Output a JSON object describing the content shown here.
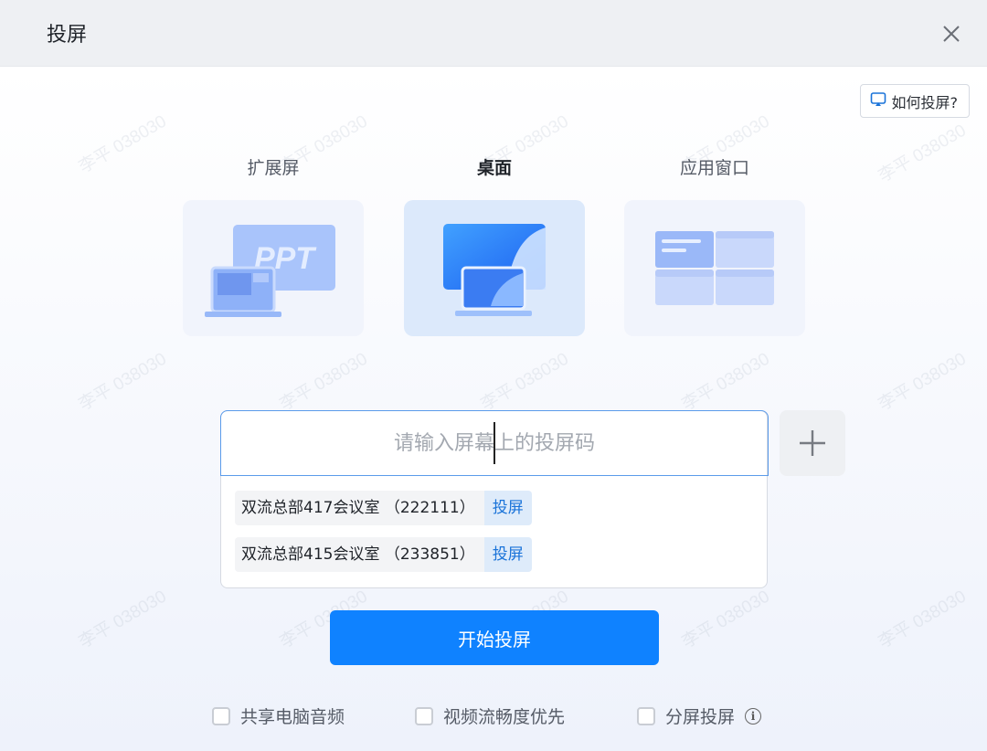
{
  "window": {
    "title": "投屏"
  },
  "watermark": "李平 038030",
  "help": {
    "label": "如何投屏?"
  },
  "modes": [
    {
      "label": "扩展屏",
      "card_text": "PPT",
      "active": false
    },
    {
      "label": "桌面",
      "active": true
    },
    {
      "label": "应用窗口",
      "active": false
    }
  ],
  "input": {
    "placeholder": "请输入屏幕上的投屏码",
    "value": ""
  },
  "recent": [
    {
      "name": "双流总部417会议室 （222111）",
      "action": "投屏"
    },
    {
      "name": "双流总部415会议室 （233851）",
      "action": "投屏"
    }
  ],
  "start": {
    "label": "开始投屏"
  },
  "options": [
    {
      "label": "共享电脑音频",
      "checked": false
    },
    {
      "label": "视频流畅度优先",
      "checked": false
    },
    {
      "label": "分屏投屏",
      "checked": false,
      "info": "i"
    }
  ],
  "colors": {
    "primary": "#0f82ff",
    "accent_text": "#1a73d9"
  }
}
